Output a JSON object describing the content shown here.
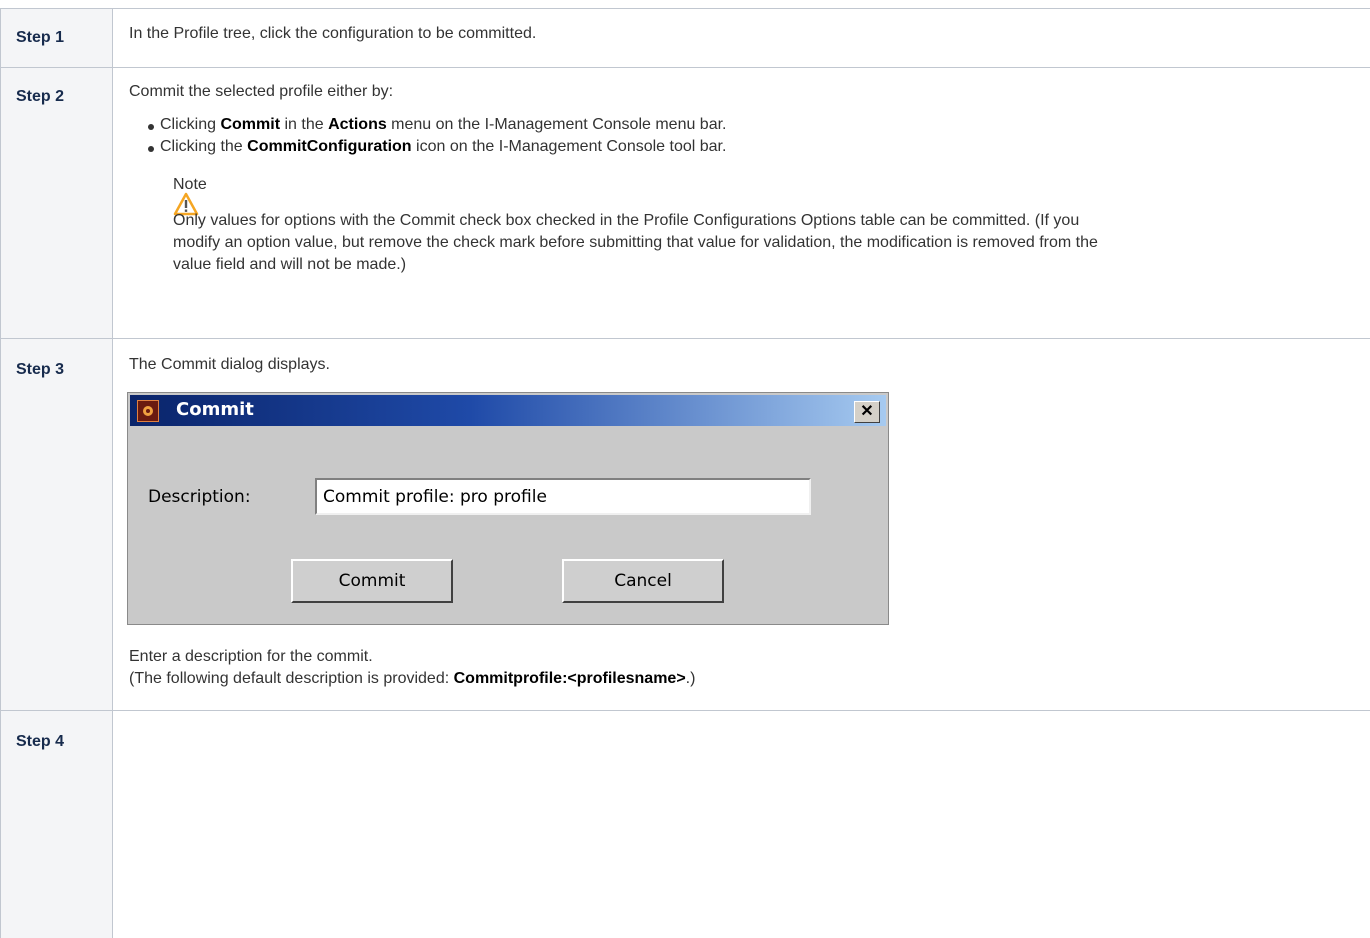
{
  "steps": [
    {
      "label": "Step 1",
      "text": "In the Profile tree, click the configuration to be committed."
    },
    {
      "label": "Step 2",
      "intro": "Commit the selected profile either by:",
      "bullet1": {
        "pre": "Clicking ",
        "b1": "Commit",
        "mid": " in the ",
        "b2": "Actions",
        "post": " menu on the I-Management Console menu bar."
      },
      "bullet2": {
        "pre": "Clicking the ",
        "b1": "CommitConfiguration",
        "post": " icon on the I-Management Console tool bar."
      },
      "note_title": "Note",
      "note_lines": [
        "Only values for options with the Commit check box checked in the Profile Configurations Options table can be committed. (If you",
        "modify an option value, but remove the check mark before submitting that value for validation, the modification is removed from the",
        "value field and will not be made.)"
      ]
    },
    {
      "label": "Step 3",
      "text": "The Commit dialog displays.",
      "after1": "Enter a description for the commit.",
      "after2_pre": "(The following default description is provided: ",
      "after2_b": "Commitprofile:<profilesname>",
      "after2_post": ".)"
    },
    {
      "label": "Step 4"
    }
  ],
  "dialog": {
    "title": "Commit",
    "description_label": "Description:",
    "description_value": "Commit profile: pro profile",
    "commit_label": "Commit",
    "cancel_label": "Cancel",
    "close_glyph": "✕"
  },
  "colors": {
    "header_bg": "#f4f5f7",
    "border": "#c1c7d0",
    "warning": "#f5a623"
  }
}
